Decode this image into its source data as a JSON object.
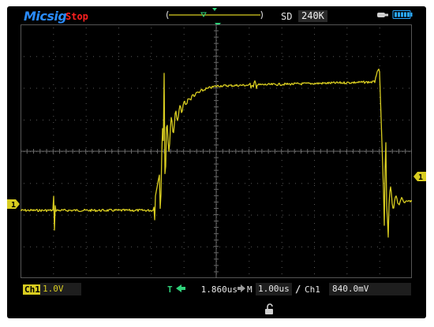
{
  "header": {
    "brand": "Micsig",
    "run_state": "Stop",
    "sd_label": "SD",
    "memory_depth": "240K"
  },
  "markers": {
    "trigger_top": "T",
    "channel_left": "1",
    "channel_right": "1"
  },
  "bottom": {
    "channel_badge": "Ch1",
    "volts_per_div": "1.0V",
    "trigger_t": "T",
    "horizontal_position": "1.860us",
    "timebase_label": "M",
    "time_per_div": "1.00us",
    "trigger_slope": "/",
    "trigger_source": "Ch1",
    "trigger_level": "840.0mV"
  },
  "colors": {
    "trace": "#d8cc20",
    "trigger": "#2fd27a",
    "brand": "#2a8cff",
    "stop": "#ff2020"
  },
  "icons": [
    "usb-icon",
    "battery-icon",
    "lock-icon",
    "arrow-left-icon",
    "arrow-right-icon"
  ]
}
